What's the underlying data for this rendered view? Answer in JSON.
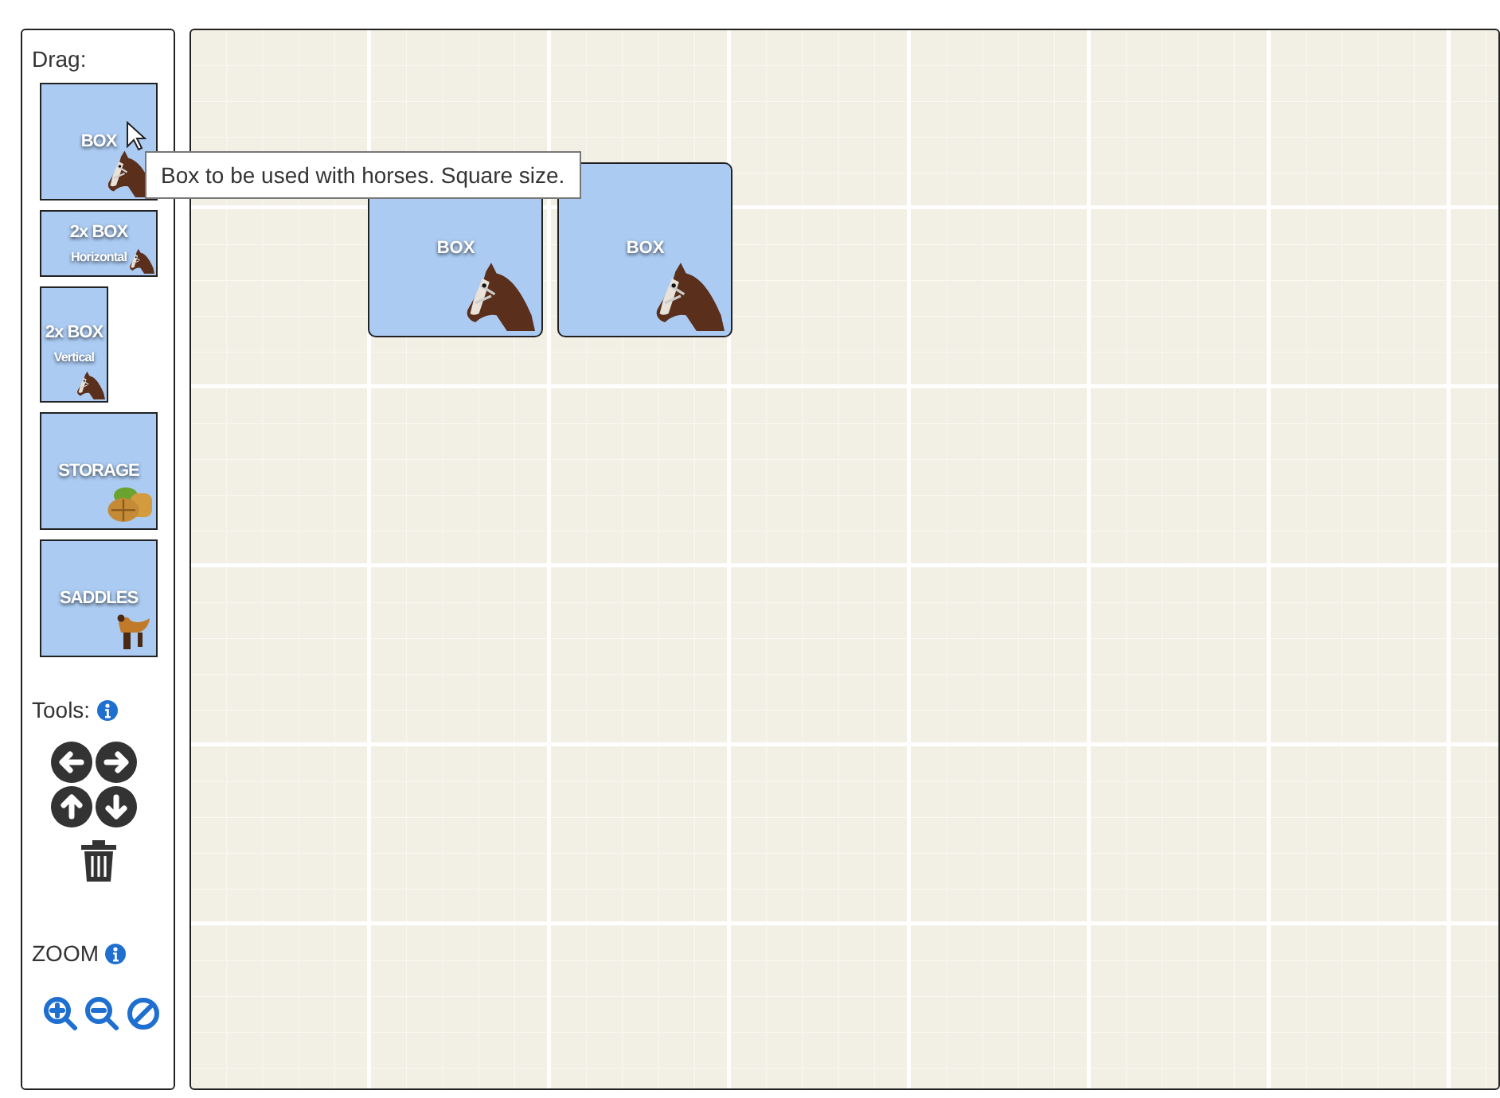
{
  "palette": {
    "heading": "Drag:",
    "items": [
      {
        "kind": "box",
        "label": "BOX"
      },
      {
        "kind": "box_wide",
        "label": "2x BOX",
        "sublabel": "Horizontal"
      },
      {
        "kind": "box_tall",
        "label": "2x BOX",
        "sublabel": "Vertical"
      },
      {
        "kind": "storage",
        "label": "STORAGE"
      },
      {
        "kind": "saddles",
        "label": "SADDLES"
      }
    ]
  },
  "tooltip": "Box to be used with horses. Square size.",
  "tools": {
    "heading": "Tools:"
  },
  "zoom": {
    "heading": "ZOOM"
  },
  "canvas": {
    "items": [
      {
        "kind": "box",
        "label": "BOX"
      },
      {
        "kind": "box",
        "label": "BOX"
      }
    ]
  }
}
